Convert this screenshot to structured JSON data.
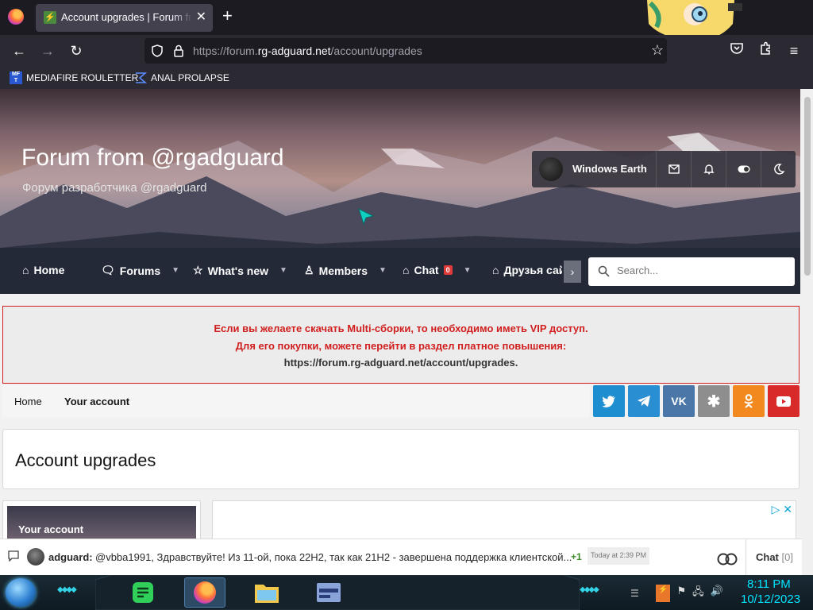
{
  "browser": {
    "tab_title": "Account upgrades | Forum from @rgadguard",
    "url_prefix": "https://forum.",
    "url_domain": "rg-adguard.net",
    "url_path": "/account/upgrades",
    "bookmarks": [
      {
        "label": "MEDIAFIRE ROULETTER",
        "icon": "MF T"
      },
      {
        "label": "ANAL PROLAPSE"
      }
    ]
  },
  "site": {
    "title": "Forum from @rgadguard",
    "subtitle": "Форум разработчика @rgadguard",
    "username": "Windows Earth"
  },
  "nav": {
    "items": [
      {
        "label": "Home"
      },
      {
        "label": "Forums"
      },
      {
        "label": "What's new"
      },
      {
        "label": "Members"
      },
      {
        "label": "Chat",
        "badge": "0"
      },
      {
        "label": "Друзья сайта"
      }
    ],
    "search_placeholder": "Search..."
  },
  "notice": {
    "line1": "Если вы желаете скачать Multi-сборки, то необходимо иметь VIP доступ.",
    "line2": "Для его покупки, можете перейти в раздел платное повышения:",
    "line3": "https://forum.rg-adguard.net/account/upgrades."
  },
  "breadcrumb": {
    "home": "Home",
    "account": "Your account"
  },
  "social": [
    {
      "name": "twitter",
      "color": "#1f8ed0"
    },
    {
      "name": "telegram",
      "color": "#2a8ed2"
    },
    {
      "name": "vk",
      "color": "#4a76a8"
    },
    {
      "name": "livejournal",
      "color": "#8e8e8e"
    },
    {
      "name": "odnoklassniki",
      "color": "#f1891f"
    },
    {
      "name": "youtube",
      "color": "#d92a2a"
    }
  ],
  "page": {
    "title": "Account upgrades",
    "sidebar_label": "Your account"
  },
  "chat": {
    "user": "adguard:",
    "message": "@vbba1991, Здравствуйте! Из 11-ой, пока 22H2, так как 21H2 - завершена поддержка клиентской...",
    "plus": "+1",
    "time": "Today at 2:39 PM",
    "tab_label": "Chat",
    "tab_count": "[0]"
  },
  "taskbar": {
    "time": "8:11 PM",
    "date": "10/12/2023"
  }
}
